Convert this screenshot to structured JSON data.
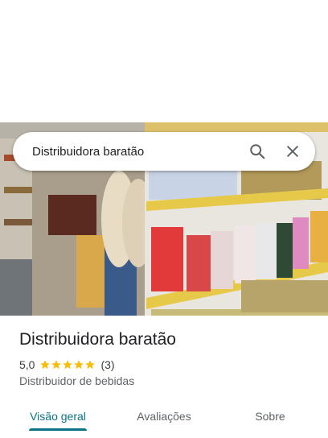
{
  "search": {
    "query": "Distribuidora baratão"
  },
  "place": {
    "name": "Distribuidora baratão",
    "rating": "5,0",
    "stars": 5,
    "review_count": "(3)",
    "category": "Distribuidor de bebidas"
  },
  "tabs": [
    {
      "label": "Visão geral",
      "active": true
    },
    {
      "label": "Avaliações",
      "active": false
    },
    {
      "label": "Sobre",
      "active": false
    }
  ],
  "icons": {
    "search": "search-icon",
    "close": "close-icon",
    "star": "star-icon"
  },
  "colors": {
    "accent": "#0b7285",
    "star": "#fbbc04",
    "title": "#202124",
    "muted": "#5f6368"
  }
}
